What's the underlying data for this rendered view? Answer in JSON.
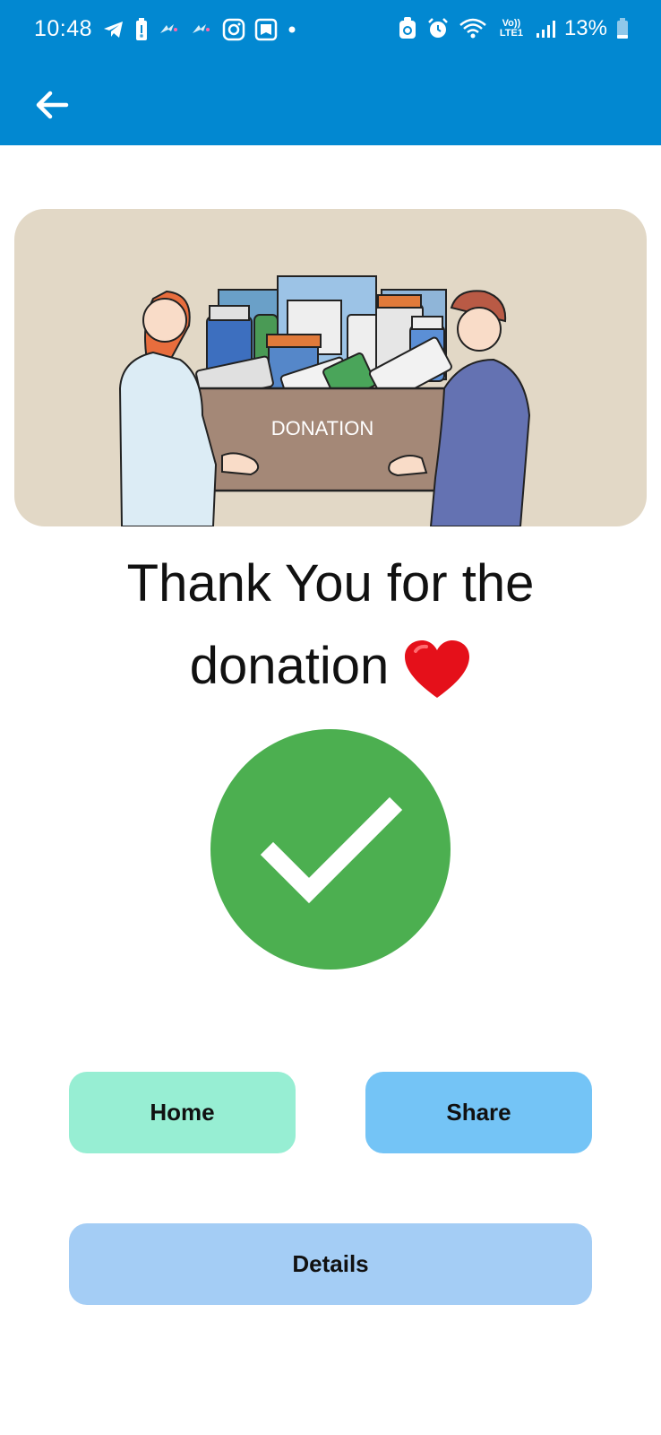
{
  "status_bar": {
    "time": "10:48",
    "network": "Vo)) LTE1",
    "battery": "13%"
  },
  "hero": {
    "box_label": "DONATION"
  },
  "message": {
    "line1": "Thank You for the",
    "line2": "donation"
  },
  "buttons": {
    "home": "Home",
    "share": "Share",
    "details": "Details"
  },
  "colors": {
    "app_bar": "#0288D1",
    "check_circle": "#4CAF50",
    "home_button": "#97EED3",
    "share_button": "#74C4F6",
    "details_button": "#A4CDF5",
    "hero_background": "#E2D8C6"
  },
  "icons": {
    "back": "arrow-left-icon",
    "success": "checkmark-icon",
    "heart": "heart-emoji-icon"
  }
}
